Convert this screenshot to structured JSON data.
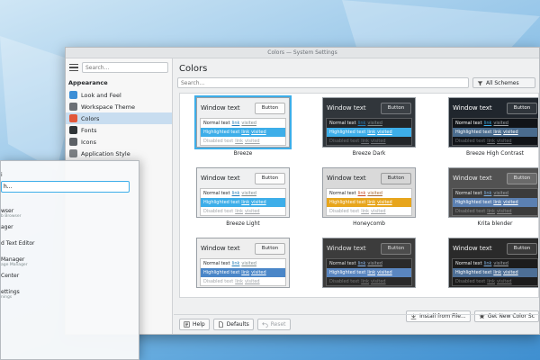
{
  "window": {
    "title": "Colors — System Settings"
  },
  "sidebar": {
    "search_placeholder": "Search...",
    "section": "Appearance",
    "items": [
      {
        "label": "Look and Feel",
        "color": "#3b8ed6",
        "active": false
      },
      {
        "label": "Workspace Theme",
        "color": "#6b6f75",
        "active": false
      },
      {
        "label": "Colors",
        "color": "#e2573a",
        "active": true
      },
      {
        "label": "Fonts",
        "color": "#2f3437",
        "active": false
      },
      {
        "label": "Icons",
        "color": "#5d6166",
        "active": false
      },
      {
        "label": "Application Style",
        "color": "#7c8084",
        "active": false
      }
    ]
  },
  "main": {
    "title": "Colors",
    "search_placeholder": "Search...",
    "filter_label": "All Schemes",
    "schemes": [
      {
        "name": "Breeze",
        "bg": "#eff0f1",
        "fg": "#232629",
        "view": "#ffffff",
        "btn": "#fcfcfc",
        "hl": "#3daee9",
        "hltext": "#ffffff",
        "link": "#2980b9",
        "visited": "#7f8c8d",
        "dis": "#a0a4a8",
        "selected": true
      },
      {
        "name": "Breeze Dark",
        "bg": "#31363b",
        "fg": "#eff0f1",
        "view": "#232629",
        "btn": "#3b4045",
        "hl": "#3daee9",
        "hltext": "#ffffff",
        "link": "#2980b9",
        "visited": "#7f8c8d",
        "dis": "#6e7175",
        "selected": false
      },
      {
        "name": "Breeze High Contrast",
        "bg": "#20262d",
        "fg": "#ffffff",
        "view": "#111418",
        "btn": "#2f353b",
        "hl": "#4a6c8e",
        "hltext": "#ffffff",
        "link": "#3daee9",
        "visited": "#a0a4a8",
        "dis": "#6e7175",
        "selected": false
      },
      {
        "name": "Breeze Light",
        "bg": "#eff0f1",
        "fg": "#232629",
        "view": "#ffffff",
        "btn": "#fcfcfc",
        "hl": "#3daee9",
        "hltext": "#ffffff",
        "link": "#2980b9",
        "visited": "#7f8c8d",
        "dis": "#a0a4a8",
        "selected": false
      },
      {
        "name": "Honeycomb",
        "bg": "#d9d9d9",
        "fg": "#232629",
        "view": "#ffffff",
        "btn": "#d6d6d6",
        "hl": "#e7a51c",
        "hltext": "#ffffff",
        "link": "#c54a26",
        "visited": "#a66b3a",
        "dis": "#a0a4a8",
        "selected": false
      },
      {
        "name": "Krita blender",
        "bg": "#525252",
        "fg": "#e8e8e8",
        "view": "#3b3b3b",
        "btn": "#6a6a6a",
        "hl": "#5b80b2",
        "hltext": "#ffffff",
        "link": "#7fb1e2",
        "visited": "#a0a4a8",
        "dis": "#8a8a8a",
        "selected": false
      },
      {
        "name": "",
        "bg": "#eeeeee",
        "fg": "#232629",
        "view": "#ffffff",
        "btn": "#f5f5f5",
        "hl": "#4a86c8",
        "hltext": "#ffffff",
        "link": "#2980b9",
        "visited": "#7f8c8d",
        "dis": "#a0a4a8",
        "selected": false
      },
      {
        "name": "",
        "bg": "#3c3c3c",
        "fg": "#e0e0e0",
        "view": "#2a2a2a",
        "btn": "#4c4c4c",
        "hl": "#5a86c0",
        "hltext": "#ffffff",
        "link": "#8ab4e8",
        "visited": "#a0a4a8",
        "dis": "#777777",
        "selected": false
      },
      {
        "name": "",
        "bg": "#2a2a2a",
        "fg": "#f0f0f0",
        "view": "#1c1c1c",
        "btn": "#3a3a3a",
        "hl": "#4d6f96",
        "hltext": "#ffffff",
        "link": "#7fb1e2",
        "visited": "#a0a4a8",
        "dis": "#777777",
        "selected": false
      }
    ],
    "preview": {
      "window_text": "Window text",
      "button": "Button",
      "normal_text": "Normal text",
      "link": "link",
      "visited": "visited",
      "highlighted_text": "Highlighted text",
      "disabled_text": "Disabled text"
    },
    "install_label": "Install from File...",
    "get_new_label": "Get New Color Sc"
  },
  "footer": {
    "help": "Help",
    "defaults": "Defaults",
    "reset": "Reset"
  },
  "launcher": {
    "user": "i",
    "search_value": "h...",
    "items": [
      {
        "title": "wser",
        "subtitle": "b Browser"
      },
      {
        "title": "ager",
        "subtitle": ""
      },
      {
        "title": "d Text Editor",
        "subtitle": ""
      },
      {
        "title": "Manager",
        "subtitle": "age Manager"
      },
      {
        "title": "Center",
        "subtitle": ""
      },
      {
        "title": "ettings",
        "subtitle": "nings"
      }
    ]
  }
}
